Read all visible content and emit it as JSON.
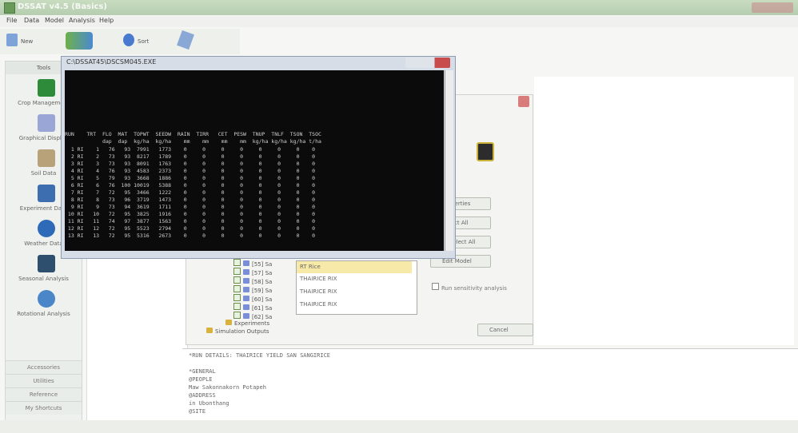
{
  "app": {
    "title": "DSSAT v4.5 (Basics)"
  },
  "menu": [
    "File",
    "Data",
    "Model",
    "Analysis",
    "Help"
  ],
  "toolbar": {
    "new_label": "New",
    "sort_label": "Sort"
  },
  "left_panel": {
    "header": "Tools",
    "tools": [
      "Crop Management",
      "Graphical Display",
      "Soil Data",
      "Experiment Data",
      "Weather Data",
      "Seasonal Analysis",
      "Rotational Analysis"
    ],
    "bottom": [
      "Accessories",
      "Utilities",
      "Reference",
      "My Shortcuts"
    ]
  },
  "console": {
    "title": "C:\\DSSAT45\\DSCSM045.EXE",
    "header1": "RUN    TRT  FLO  MAT  TOPWT  SEEDW  RAIN  TIRR   CET  PESW  TNUP  TNLF  TSON  TSOC",
    "header2": "            dap  dap  kg/ha  kg/ha    mm    mm    mm    mm  kg/ha kg/ha kg/ha t/ha",
    "rows": [
      "  1 RI    1   76   93  7991   1773    0     0     0     0     0     0     0    0",
      "  2 RI    2   73   93  8217   1789    0     0     0     0     0     0     0    0",
      "  3 RI    3   73   93  8091   1763    0     0     0     0     0     0     0    0",
      "  4 RI    4   76   93  4583   2373    0     0     0     0     0     0     0    0",
      "  5 RI    5   79   93  3668   1886    0     0     0     0     0     0     0    0",
      "  6 RI    6   76  100 10019   5388    0     0     0     0     0     0     0    0",
      "  7 RI    7   72   95  3466   1222    0     0     0     0     0     0     0    0",
      "  8 RI    8   73   96  3719   1473    0     0     0     0     0     0     0    0",
      "  9 RI    9   73   94  3619   1711    0     0     0     0     0     0     0    0",
      " 10 RI   10   72   95  3825   1916    0     0     0     0     0     0     0    0",
      " 11 RI   11   74   97  3877   1563    0     0     0     0     0     0     0    0",
      " 12 RI   12   72   95  5523   2794    0     0     0     0     0     0     0    0",
      " 13 RI   13   72   95  5316   2673    0     0     0     0     0     0     0    0"
    ]
  },
  "dialog": {
    "buttons": [
      "Properties",
      "Select All",
      "Deselect All",
      "Edit Model"
    ],
    "list": [
      "RT Rice",
      "THAIRICE RIX",
      "THAIRICE RIX",
      "THAIRICE RIX"
    ],
    "run_sensitivity": "Run sensitivity analysis",
    "cancel": "Cancel",
    "tree": [
      "[55] Sa",
      "[57] Sa",
      "[58] Sa",
      "[59] Sa",
      "[60] Sa",
      "[61] Sa",
      "[62] Sa",
      "Experiments",
      "Simulation Outputs"
    ]
  },
  "output": {
    "lines": [
      "*RUN DETAILS:  THAIRICE YIELD SAN SANGIRICE",
      "",
      "*GENERAL",
      "@PEOPLE",
      "Maw Sakonnakorn Potapeh",
      "@ADDRESS",
      "in Ubonthang",
      "@SITE"
    ]
  },
  "colors": {
    "titlebar": "#c9dcc0",
    "console_bg": "#0b0b0b",
    "close_red": "#c94c4c"
  }
}
